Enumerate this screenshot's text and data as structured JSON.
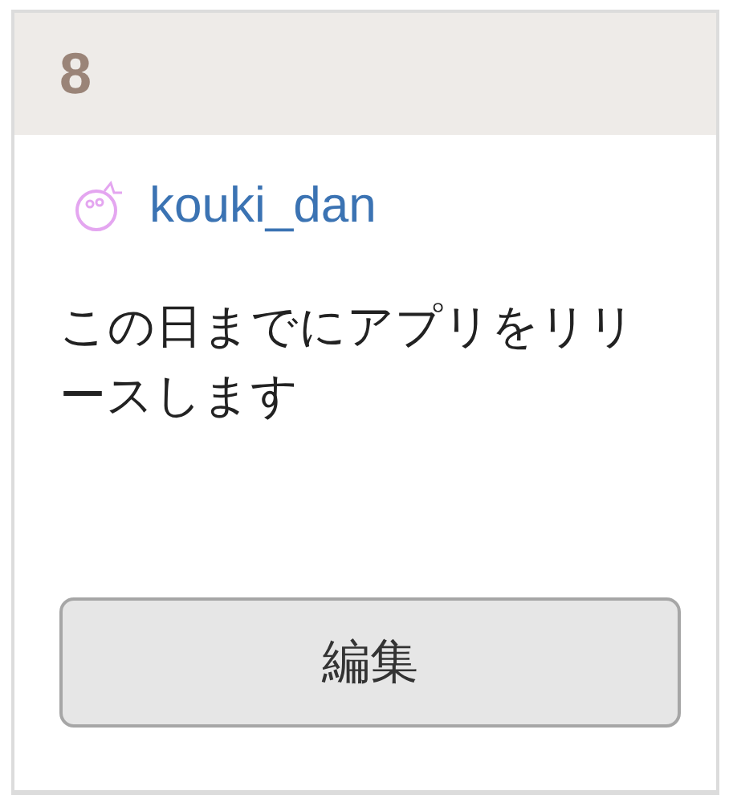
{
  "day": "8",
  "entry": {
    "user": "kouki_dan",
    "text": "この日までにアプリをリリースします"
  },
  "buttons": [
    {
      "label": "編集"
    }
  ]
}
